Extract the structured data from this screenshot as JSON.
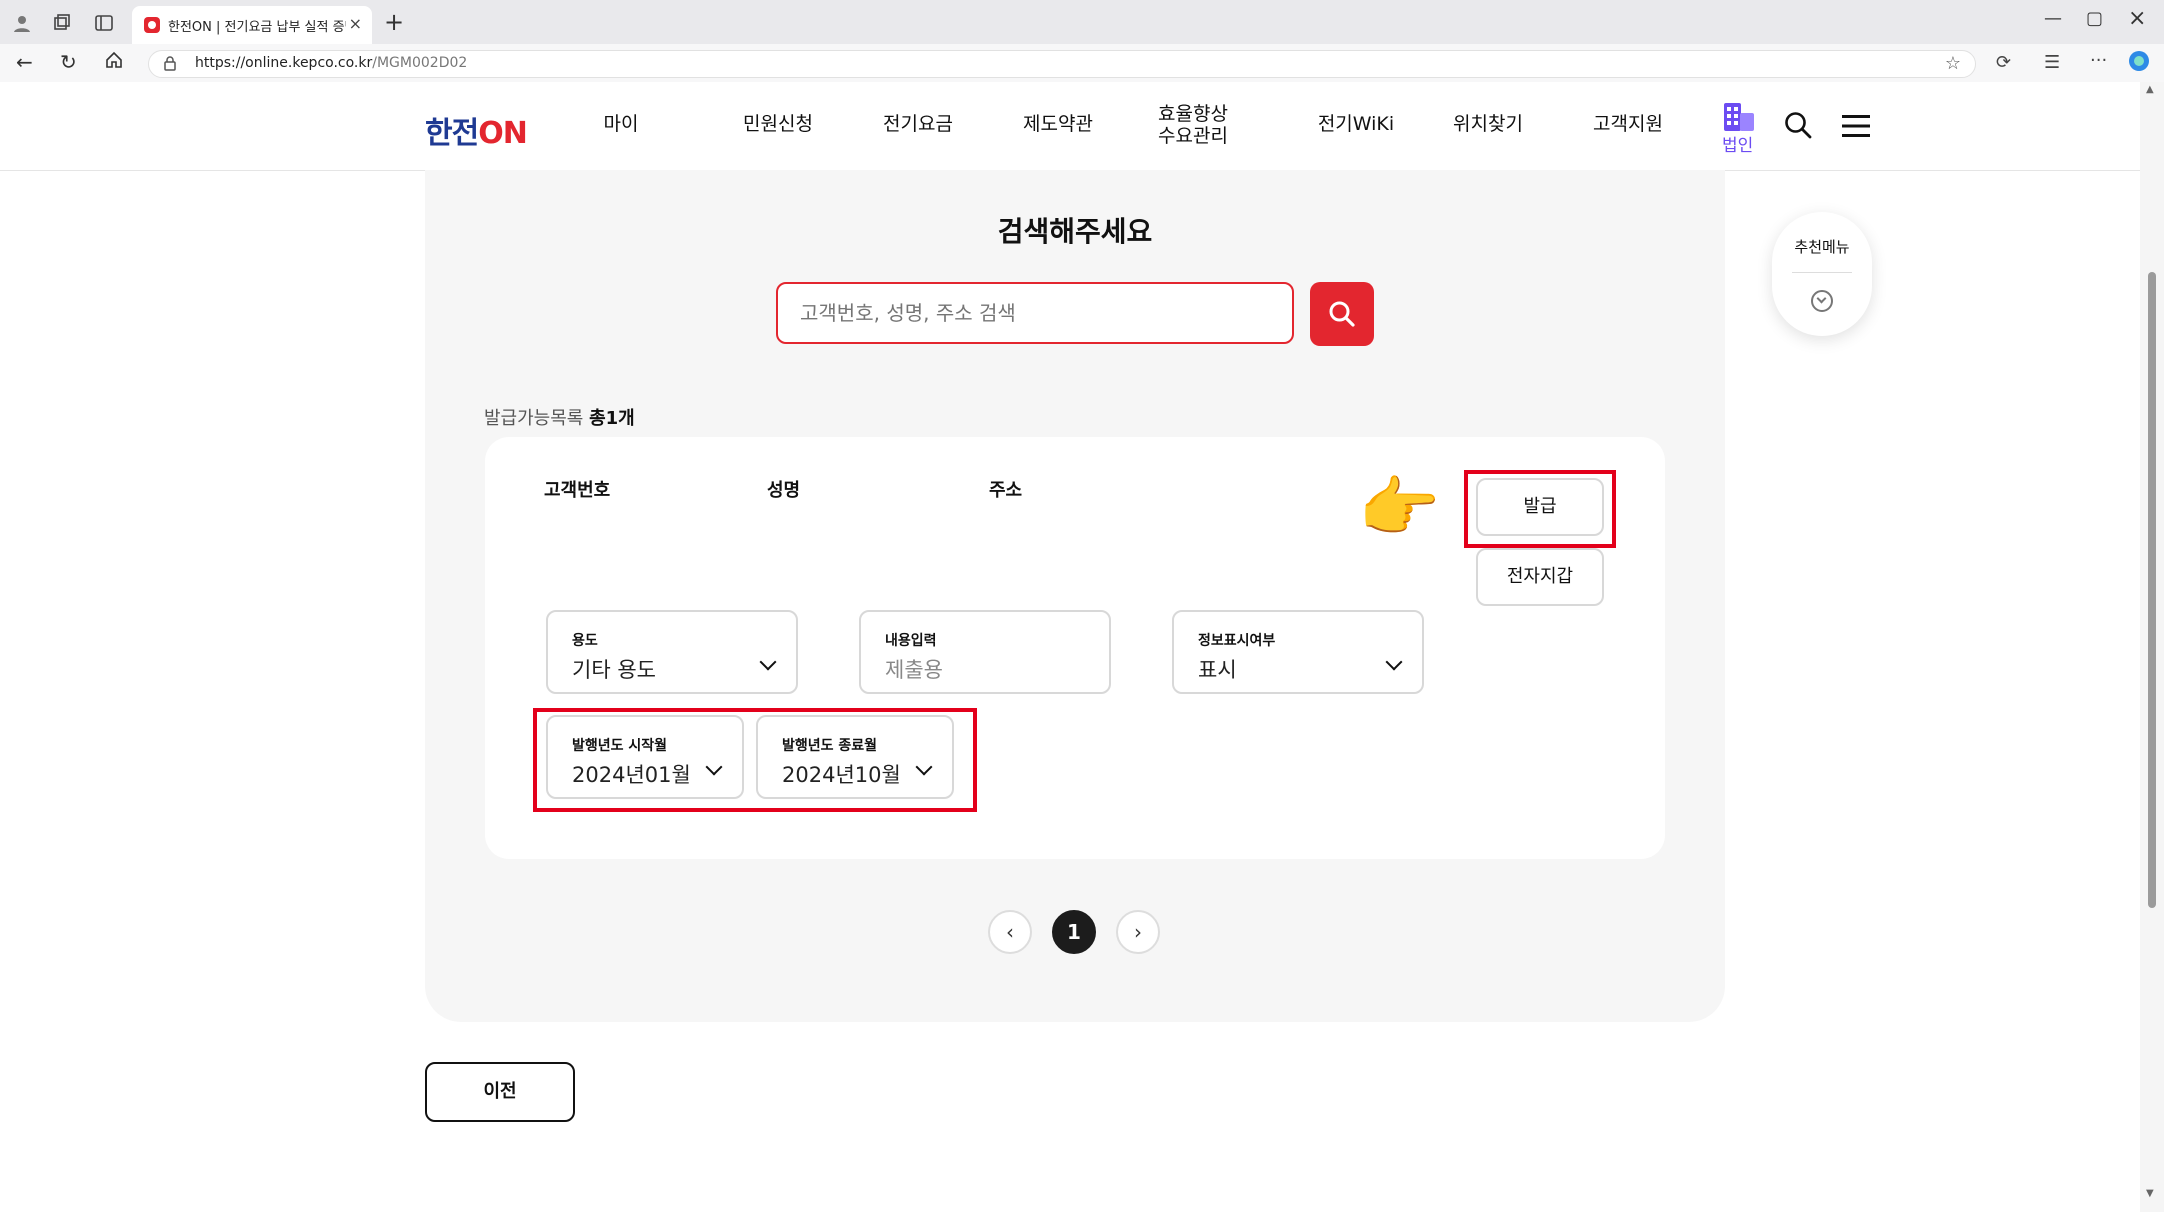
{
  "browser": {
    "tab_title": "한전ON | 전기요금 납부 실적 증명",
    "url_host": "https://online.kepco.co.kr",
    "url_path": "/MGM002D02",
    "tab_close": "×",
    "new_tab": "+"
  },
  "header": {
    "logo_main": "한전",
    "logo_on": "ON",
    "nav": [
      "마이",
      "민원신청",
      "전기요금",
      "제도약관",
      "효율향상\n수요관리",
      "전기WiKi",
      "위치찾기",
      "고객지원"
    ],
    "corp_label": "법인"
  },
  "search": {
    "title": "검색해주세요",
    "placeholder": "고객번호, 성명, 주소 검색"
  },
  "list": {
    "count_label": "발급가능목록",
    "count_value": "총1개",
    "columns": [
      "고객번호",
      "성명",
      "주소"
    ],
    "issue_button": "발급",
    "ewallet_button": "전자지갑"
  },
  "fields": {
    "usage": {
      "label": "용도",
      "value": "기타 용도"
    },
    "content": {
      "label": "내용입력",
      "placeholder": "제출용"
    },
    "display": {
      "label": "정보표시여부",
      "value": "표시"
    },
    "start_month": {
      "label": "발행년도 시작월",
      "value": "2024년01월"
    },
    "end_month": {
      "label": "발행년도 종료월",
      "value": "2024년10월"
    }
  },
  "pagination": {
    "prev": "‹",
    "current": "1",
    "next": "›"
  },
  "prev_button": "이전",
  "recommend": {
    "label": "추천메뉴"
  },
  "annotation": {
    "pointer": "👉",
    "highlight_color": "#e3001b"
  },
  "colors": {
    "brand_red": "#e3262f",
    "brand_blue": "#1f3a93",
    "corp_purple": "#6c4cf2"
  }
}
